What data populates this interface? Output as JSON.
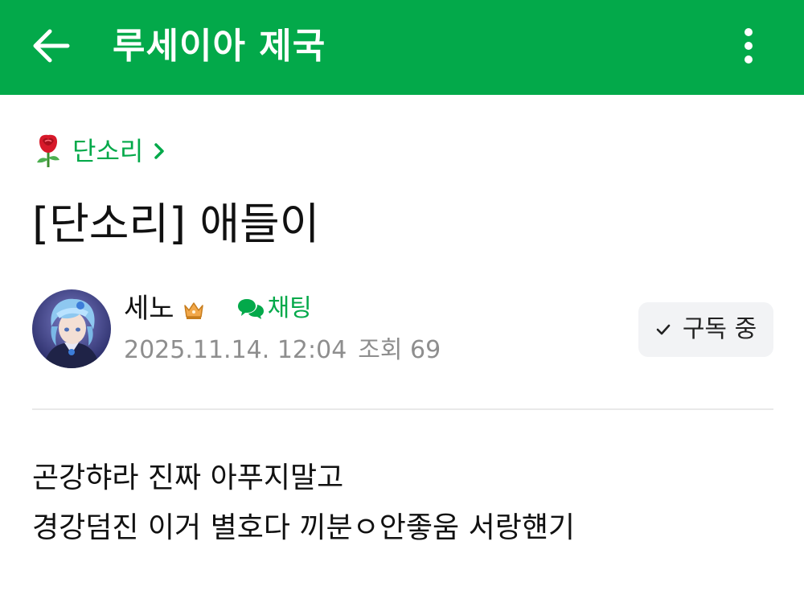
{
  "header": {
    "title": "루세이아 제국",
    "back_icon": "arrow-left-icon",
    "more_icon": "more-vertical-icon",
    "background_color": "#03a94a"
  },
  "board": {
    "emoji_icon": "rose-icon",
    "name": "단소리",
    "chevron_icon": "chevron-right-icon",
    "accent_color": "#03a94a"
  },
  "post": {
    "title": "[단소리] 애들이",
    "author": {
      "name": "세노",
      "badge_icon": "crown-icon",
      "avatar_icon": "avatar"
    },
    "chat_label": "채팅",
    "date": "2025.11.14. 12:04",
    "views_label": "조회 69",
    "subscribe_label": "구독 중",
    "body_lines": [
      "곤강햐라 진짜 아푸지말고",
      "경강덤진 이거 별호다 끼분ㅇ안좋움 서랑햰기"
    ]
  }
}
